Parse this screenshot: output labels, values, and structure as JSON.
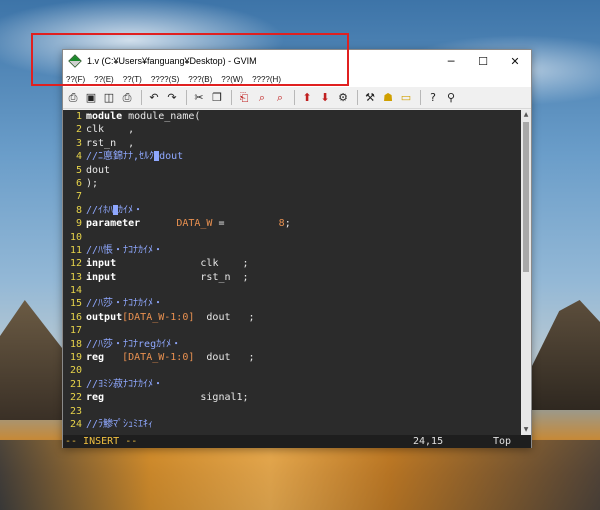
{
  "window": {
    "title": "1.v (C:¥Users¥fanguang¥Desktop) - GVIM",
    "minimize_glyph": "─",
    "maximize_glyph": "☐",
    "close_glyph": "✕"
  },
  "menu": [
    "??(F)",
    "??(E)",
    "??(T)",
    "????(S)",
    "???(B)",
    "??(W)",
    "????(H)"
  ],
  "toolbar_icons": [
    "open-icon",
    "save-icon",
    "save-all-icon",
    "print-icon",
    "undo-icon",
    "redo-icon",
    "cut-icon",
    "copy-icon",
    "paste-icon",
    "find-icon",
    "find-next-icon",
    "load-session-icon",
    "save-session-icon",
    "run-script-icon",
    "make-icon",
    "run-ctags-icon",
    "jump-tag-icon",
    "help-icon",
    "find-help-icon"
  ],
  "editor": {
    "lines": [
      {
        "n": "1",
        "parts": [
          {
            "c": "kw",
            "t": "module"
          },
          {
            "c": "",
            "t": " module_name("
          }
        ]
      },
      {
        "n": "2",
        "parts": [
          {
            "c": "",
            "t": "clk    ,"
          }
        ]
      },
      {
        "n": "3",
        "parts": [
          {
            "c": "",
            "t": "rst_n  ,"
          }
        ]
      },
      {
        "n": "4",
        "parts": [
          {
            "c": "cm",
            "t": "//ﾆ悳錦ﾅﾅ,ｾﾙｸ"
          },
          {
            "c": "blk",
            "t": ""
          },
          {
            "c": "cm",
            "t": "dout"
          }
        ]
      },
      {
        "n": "5",
        "parts": [
          {
            "c": "",
            "t": "dout"
          }
        ]
      },
      {
        "n": "6",
        "parts": [
          {
            "c": "",
            "t": ");"
          }
        ]
      },
      {
        "n": "7",
        "parts": []
      },
      {
        "n": "8",
        "parts": [
          {
            "c": "cm",
            "t": "//ｲﾎﾊ"
          },
          {
            "c": "blk",
            "t": ""
          },
          {
            "c": "cm",
            "t": "ｶｲﾒ・"
          }
        ]
      },
      {
        "n": "9",
        "parts": [
          {
            "c": "kw",
            "t": "parameter"
          },
          {
            "c": "",
            "t": "      "
          },
          {
            "c": "pm",
            "t": "DATA_W"
          },
          {
            "c": "",
            "t": " =         "
          },
          {
            "c": "num",
            "t": "8"
          },
          {
            "c": "",
            "t": ";"
          }
        ]
      },
      {
        "n": "10",
        "parts": []
      },
      {
        "n": "11",
        "parts": [
          {
            "c": "cm",
            "t": "//ﾊ悵・ﾅｺﾅｶｲﾒ・"
          }
        ]
      },
      {
        "n": "12",
        "parts": [
          {
            "c": "kw",
            "t": "input"
          },
          {
            "c": "",
            "t": "              clk    ;"
          }
        ]
      },
      {
        "n": "13",
        "parts": [
          {
            "c": "kw",
            "t": "input"
          },
          {
            "c": "",
            "t": "              rst_n  ;"
          }
        ]
      },
      {
        "n": "14",
        "parts": []
      },
      {
        "n": "15",
        "parts": [
          {
            "c": "cm",
            "t": "//ﾊ莎・ﾅｺﾅｶｲﾒ・"
          }
        ]
      },
      {
        "n": "16",
        "parts": [
          {
            "c": "kw",
            "t": "output"
          },
          {
            "c": "num",
            "t": "[DATA_W-1:0]"
          },
          {
            "c": "",
            "t": "  dout   ;"
          }
        ]
      },
      {
        "n": "17",
        "parts": []
      },
      {
        "n": "18",
        "parts": [
          {
            "c": "cm",
            "t": "//ﾊ莎・ﾅｺﾅregｶｲﾒ・"
          }
        ]
      },
      {
        "n": "19",
        "parts": [
          {
            "c": "kw",
            "t": "reg"
          },
          {
            "c": "",
            "t": "   "
          },
          {
            "c": "num",
            "t": "[DATA_W-1:0]"
          },
          {
            "c": "",
            "t": "  dout   ;"
          }
        ]
      },
      {
        "n": "20",
        "parts": []
      },
      {
        "n": "21",
        "parts": [
          {
            "c": "cm",
            "t": "//ﾖﾐｼ菽ﾅｺﾅｶｲﾒ・"
          }
        ]
      },
      {
        "n": "22",
        "parts": [
          {
            "c": "kw",
            "t": "reg"
          },
          {
            "c": "",
            "t": "                signal1;"
          }
        ]
      },
      {
        "n": "23",
        "parts": []
      },
      {
        "n": "24",
        "parts": [
          {
            "c": "cm",
            "t": "//ﾗ鯵ﾏﾟｼｭﾐｴｷｨ"
          }
        ]
      }
    ]
  },
  "status": {
    "mode": "-- INSERT --",
    "position": "24,15",
    "scroll": "Top"
  },
  "colors": {
    "editor_bg": "#2b2b2b",
    "line_number": "#e6d34a",
    "comment": "#8fa8ff",
    "constant": "#e89050",
    "highlight_box": "#e02020"
  }
}
